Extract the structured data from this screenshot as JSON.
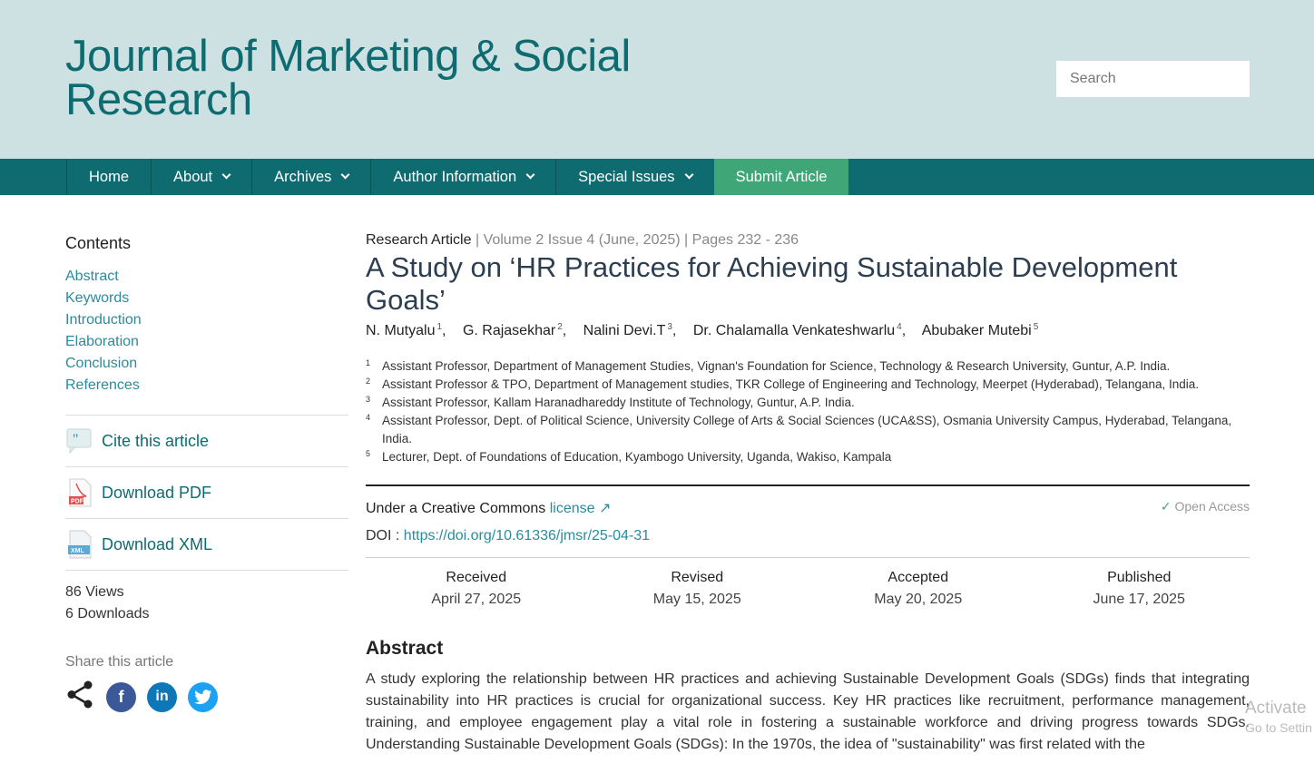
{
  "site": {
    "title": "Journal of Marketing & Social Research",
    "search_placeholder": "Search"
  },
  "nav": {
    "home": "Home",
    "about": "About",
    "archives": "Archives",
    "author_information": "Author Information",
    "special_issues": "Special Issues",
    "submit_article": "Submit Article"
  },
  "sidebar": {
    "contents_title": "Contents",
    "toc": [
      "Abstract",
      "Keywords",
      "Introduction",
      "Elaboration",
      "Conclusion",
      "References"
    ],
    "cite": "Cite this article",
    "download_pdf": "Download PDF",
    "download_xml": "Download XML",
    "views": "86 Views",
    "downloads": "6 Downloads",
    "share_label": "Share this article"
  },
  "article": {
    "type": "Research Article",
    "volume_info": "Volume 2 Issue 4 (June, 2025)",
    "pages": "Pages 232 - 236",
    "title": "A Study on ‘HR Practices for Achieving Sustainable Development Goals’",
    "authors": [
      {
        "name": "N. Mutyalu",
        "sup": "1"
      },
      {
        "name": "G. Rajasekhar",
        "sup": "2"
      },
      {
        "name": "Nalini Devi.T",
        "sup": "3"
      },
      {
        "name": "Dr. Chalamalla Venkateshwarlu",
        "sup": "4"
      },
      {
        "name": "Abubaker Mutebi",
        "sup": "5"
      }
    ],
    "affiliations": [
      {
        "num": "1",
        "text": "Assistant Professor, Department of Management Studies, Vignan's Foundation for Science, Technology & Research University, Guntur, A.P. India."
      },
      {
        "num": "2",
        "text": "Assistant Professor & TPO, Department of Management studies, TKR College of Engineering and Technology, Meerpet (Hyderabad), Telangana, India."
      },
      {
        "num": "3",
        "text": "Assistant Professor, Kallam Haranadhareddy Institute of Technology, Guntur, A.P. India."
      },
      {
        "num": "4",
        "text": "Assistant Professor, Dept. of Political Science, University College of Arts & Social Sciences (UCA&SS), Osmania University Campus, Hyderabad, Telangana, India."
      },
      {
        "num": "5",
        "text": "Lecturer, Dept. of Foundations of Education, Kyambogo University, Uganda, Wakiso, Kampala"
      }
    ],
    "license_text": "Under a Creative Commons",
    "license_link": "license",
    "open_access": "Open Access",
    "doi_label": "DOI :",
    "doi_url": "https://doi.org/10.61336/jmsr/25-04-31",
    "dates": [
      {
        "label": "Received",
        "value": "April 27, 2025"
      },
      {
        "label": "Revised",
        "value": "May 15, 2025"
      },
      {
        "label": "Accepted",
        "value": "May 20, 2025"
      },
      {
        "label": "Published",
        "value": "June 17, 2025"
      }
    ],
    "abstract_heading": "Abstract",
    "abstract_text": "A study exploring the relationship between HR practices and achieving Sustainable Development Goals (SDGs) finds that integrating sustainability into HR practices is crucial for organizational success. Key HR practices like recruitment, performance management, training, and employee engagement play a vital role in fostering a sustainable workforce and driving progress towards SDGs. Understanding Sustainable Development Goals (SDGs): In the 1970s, the idea of \"sustainability\" was first related with the"
  },
  "overlay": {
    "activate": "Activate",
    "go_to_settings": "Go to Settin"
  },
  "colors": {
    "header_bg": "#cde0e2",
    "nav_bg": "#0e6b6f",
    "submit_bg": "#3fa777",
    "link": "#2b8a9b"
  }
}
